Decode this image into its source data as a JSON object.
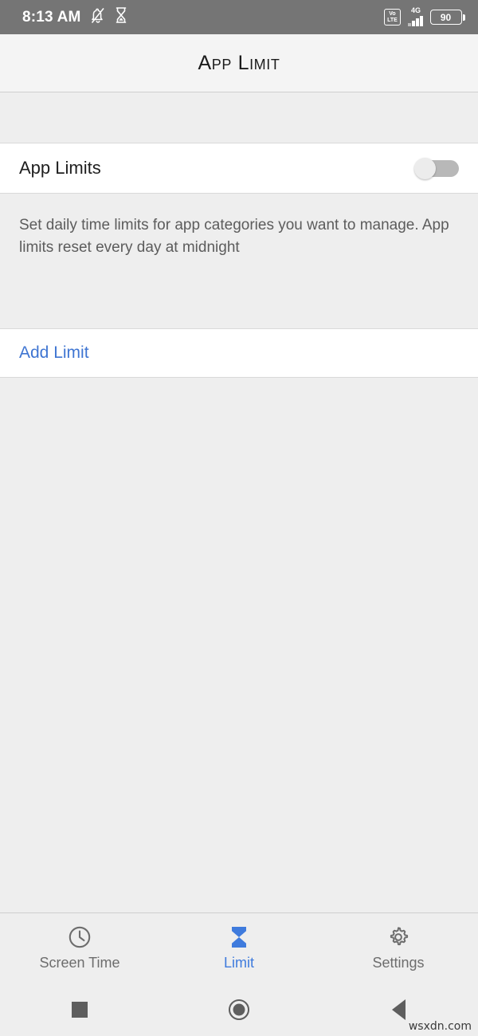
{
  "status_bar": {
    "time": "8:13 AM",
    "icons": [
      "bell-muted-icon",
      "hourglass-icon"
    ],
    "volte_top": "Vo",
    "volte_bottom": "LTE",
    "network_type": "4G",
    "battery_level": "90"
  },
  "header": {
    "title": "App Limit"
  },
  "main": {
    "toggle_row": {
      "label": "App Limits",
      "toggle_state": "off"
    },
    "description": "Set daily time limits for app categories you want to manage. App limits reset every day at midnight",
    "action": {
      "label": "Add Limit"
    }
  },
  "tab_bar": {
    "tabs": [
      {
        "label": "Screen Time",
        "icon": "clock-icon",
        "active": false
      },
      {
        "label": "Limit",
        "icon": "hourglass-icon",
        "active": true
      },
      {
        "label": "Settings",
        "icon": "gear-icon",
        "active": false
      }
    ]
  },
  "nav_bar": {
    "recents": "recents-square-icon",
    "home": "home-circle-icon",
    "back": "back-triangle-icon"
  },
  "watermark": "wsxdn.com",
  "colors": {
    "accent_blue": "#3f7bdd",
    "link_blue": "#3f75d2",
    "status_bar_bg": "#757575",
    "page_bg": "#eeeeee",
    "card_bg": "#ffffff"
  }
}
